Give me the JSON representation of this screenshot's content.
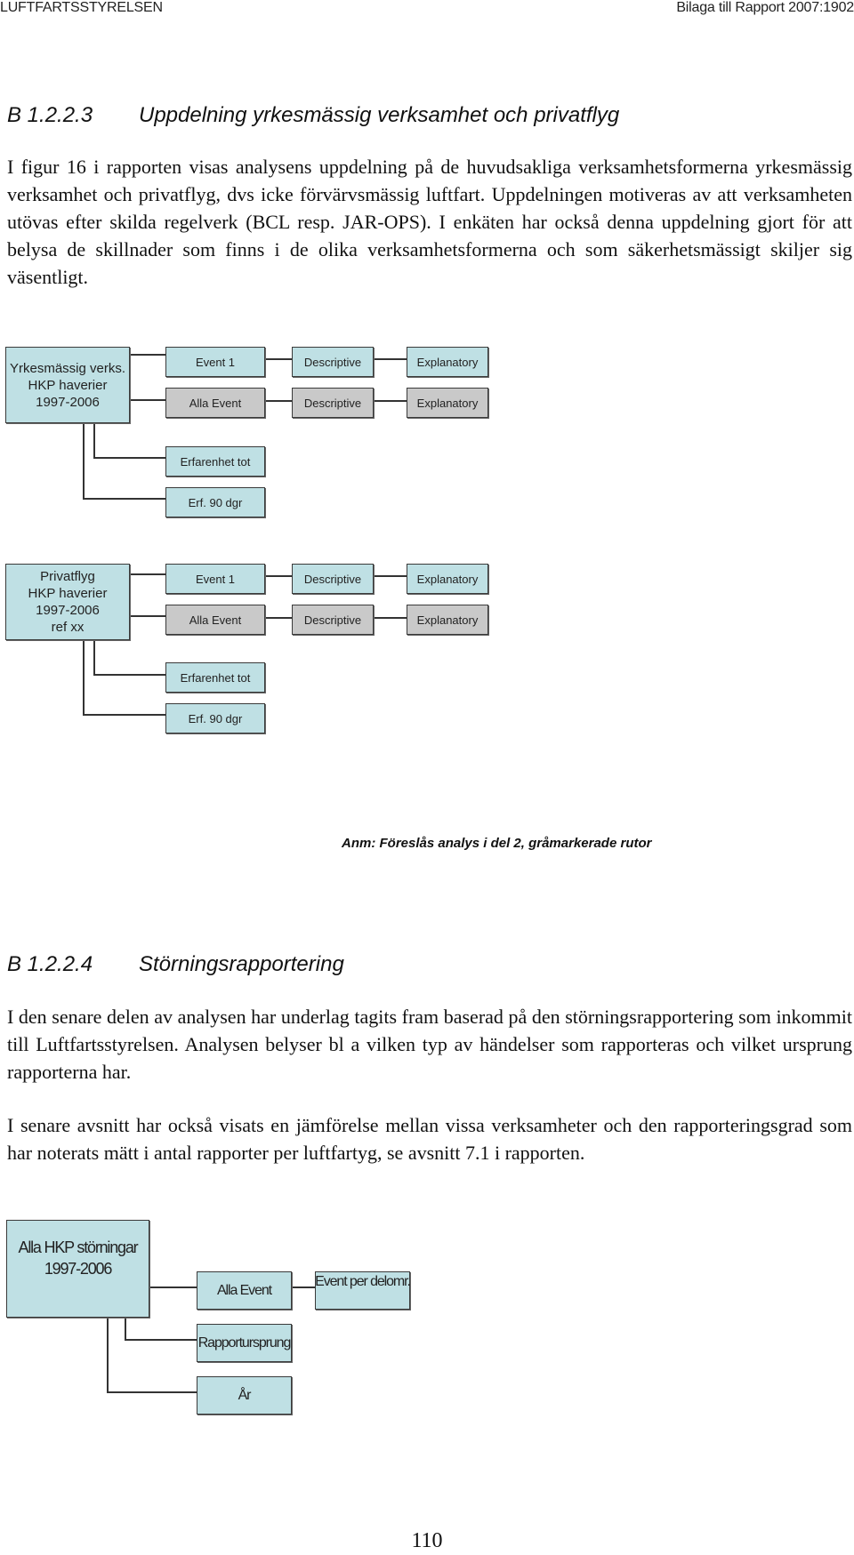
{
  "header": {
    "organization": "LUFTFARTSSTYRELSEN",
    "report_ref": "Bilaga till Rapport 2007:1902"
  },
  "section1": {
    "number": "B 1.2.2.3",
    "title": "Uppdelning yrkesmässig verksamhet och privatflyg",
    "paragraph": "I figur 16 i rapporten visas analysens uppdelning på de huvudsakliga verksamhetsformerna yrkesmässig verksamhet och privatflyg, dvs icke förvärvsmässig luftfart. Uppdelningen motiveras av att verksamheten utövas efter skilda regelverk (BCL resp. JAR-OPS). I enkäten har också denna uppdelning gjort för att belysa de skillnader som finns i de olika verksamhetsformerna och som säkerhetsmässigt skiljer sig väsentligt."
  },
  "diagram1": {
    "root": [
      "Yrkesmässig verks.",
      "HKP haverier",
      "1997-2006"
    ],
    "row1": [
      "Event 1",
      "Descriptive",
      "Explanatory"
    ],
    "row2": [
      "Alla Event",
      "Descriptive",
      "Explanatory"
    ],
    "sub1": "Erfarenhet tot",
    "sub2": "Erf. 90 dgr"
  },
  "diagram2": {
    "root": [
      "Privatflyg",
      "HKP haverier",
      "1997-2006",
      "ref xx"
    ],
    "row1": [
      "Event 1",
      "Descriptive",
      "Explanatory"
    ],
    "row2": [
      "Alla Event",
      "Descriptive",
      "Explanatory"
    ],
    "sub1": "Erfarenhet tot",
    "sub2": "Erf. 90 dgr"
  },
  "note": "Anm: Föreslås analys i del 2, gråmarkerade rutor",
  "section2": {
    "number": "B 1.2.2.4",
    "title": "Störningsrapportering",
    "paragraph1": "I den senare delen av analysen har underlag tagits fram baserad på den störningsrapportering som inkommit till Luftfartsstyrelsen. Analysen belyser bl a vilken typ av händelser som rapporteras och vilket ursprung rapporterna har.",
    "paragraph2": "I senare avsnitt har också visats en jämförelse mellan vissa verksamheter och den rapporteringsgrad som har noterats mätt i antal rapporter per luftfartyg, se avsnitt 7.1 i rapporten."
  },
  "diagram3": {
    "root": [
      "Alla HKP störningar",
      "1997-2006"
    ],
    "event": "Alla Event",
    "event_detail": "Event per delomr.",
    "origin": "Rapportursprung",
    "year": "År"
  },
  "colors": {
    "box_blue": "#bfe0e4",
    "box_gray": "#c9c9c9"
  },
  "page_number": "110"
}
